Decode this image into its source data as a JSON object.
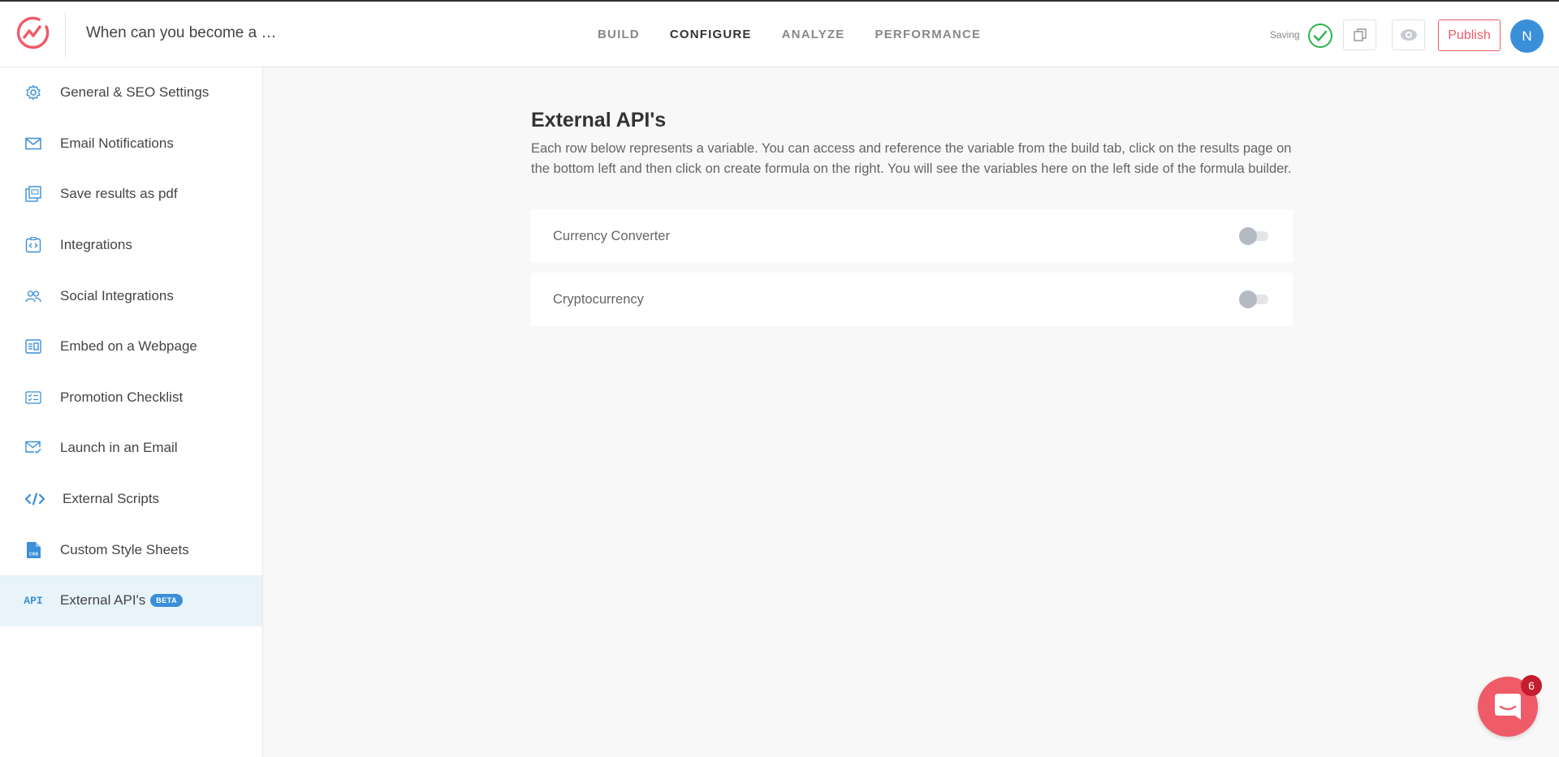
{
  "header": {
    "title": "When can you become a …",
    "tabs": [
      {
        "label": "BUILD",
        "active": false
      },
      {
        "label": "CONFIGURE",
        "active": true
      },
      {
        "label": "ANALYZE",
        "active": false
      },
      {
        "label": "PERFORMANCE",
        "active": false
      }
    ],
    "saving_label": "Saving",
    "publish_label": "Publish",
    "avatar_initial": "N"
  },
  "sidebar": {
    "items": [
      {
        "label": "General & SEO Settings",
        "icon": "gear-icon"
      },
      {
        "label": "Email Notifications",
        "icon": "envelope-icon"
      },
      {
        "label": "Save results as pdf",
        "icon": "pdf-icon"
      },
      {
        "label": "Integrations",
        "icon": "integrations-icon"
      },
      {
        "label": "Social Integrations",
        "icon": "users-icon"
      },
      {
        "label": "Embed on a Webpage",
        "icon": "embed-icon"
      },
      {
        "label": "Promotion Checklist",
        "icon": "checklist-icon"
      },
      {
        "label": "Launch in an Email",
        "icon": "email-check-icon"
      },
      {
        "label": "External Scripts",
        "icon": "code-icon"
      },
      {
        "label": "Custom Style Sheets",
        "icon": "css-file-icon"
      },
      {
        "label": "External API's",
        "icon": "api-icon",
        "icon_text": "API",
        "badge": "BETA",
        "active": true
      }
    ]
  },
  "main": {
    "title": "External API's",
    "description": "Each row below represents a variable. You can access and reference the variable from the build tab, click on the results page on the bottom left and then click on create formula on the right. You will see the variables here on the left side of the formula builder.",
    "apis": [
      {
        "name": "Currency Converter",
        "enabled": false
      },
      {
        "name": "Cryptocurrency",
        "enabled": false
      }
    ]
  },
  "chat": {
    "badge_count": "6"
  },
  "colors": {
    "brand": "#ef5b67",
    "accent": "#3a8fd9",
    "active_bg": "#e8f3fa"
  }
}
